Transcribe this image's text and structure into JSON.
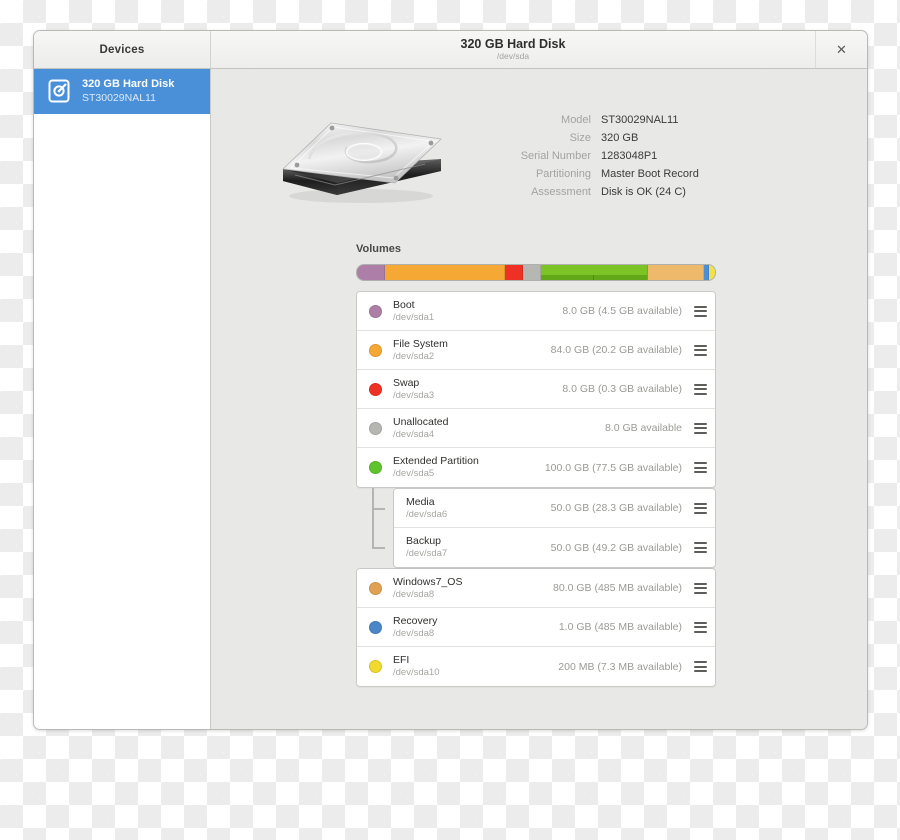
{
  "window": {
    "title": "320 GB Hard Disk",
    "subtitle": "/dev/sda",
    "close_label": "✕"
  },
  "sidebar": {
    "header_label": "Devices",
    "devices": [
      {
        "name": "320 GB Hard Disk",
        "model": "ST30029NAL11",
        "icon": "hard-disk-icon",
        "selected": true
      }
    ]
  },
  "disk": {
    "illustration": "hard-disk-illustration",
    "info": [
      {
        "label": "Model",
        "value": "ST30029NAL11"
      },
      {
        "label": "Size",
        "value": "320 GB"
      },
      {
        "label": "Serial Number",
        "value": "1283048P1"
      },
      {
        "label": "Partitioning",
        "value": "Master Boot Record"
      },
      {
        "label": "Assessment",
        "value": "Disk is OK (24 C)"
      }
    ]
  },
  "volumes": {
    "heading": "Volumes",
    "bar_segments": [
      {
        "name": "Boot",
        "color": "#ad7fa8",
        "pct": 7.8
      },
      {
        "name": "File System",
        "color": "#f5a833",
        "pct": 33.6
      },
      {
        "name": "Swap",
        "color": "#ee3124",
        "pct": 5.0
      },
      {
        "name": "Unallocated",
        "color": "#b6b6b2",
        "pct": 5.0
      },
      {
        "name": "Extended Partition",
        "color": "#7cc425",
        "pct": 30.0,
        "children": [
          {
            "name": "Media",
            "color": "#62a717",
            "pct": 50
          },
          {
            "name": "Backup",
            "color": "#62a717",
            "pct": 50
          }
        ]
      },
      {
        "name": "Windows7_OS",
        "color": "#eeb96b",
        "pct": 15.4
      },
      {
        "name": "Recovery",
        "color": "#4a90d9",
        "pct": 1.4
      },
      {
        "name": "EFI",
        "color": "#f3e04a",
        "pct": 1.8
      }
    ],
    "rows": [
      {
        "name": "Boot",
        "device": "/dev/sda1",
        "size": "8.0 GB (4.5 GB available)",
        "color": "#ad7fa8",
        "nested": false
      },
      {
        "name": "File System",
        "device": "/dev/sda2",
        "size": "84.0 GB (20.2 GB available)",
        "color": "#f5a833",
        "nested": false
      },
      {
        "name": "Swap",
        "device": "/dev/sda3",
        "size": "8.0 GB (0.3 GB available)",
        "color": "#ee3124",
        "nested": false
      },
      {
        "name": "Unallocated",
        "device": "/dev/sda4",
        "size": "8.0 GB available",
        "color": "#b6b6b2",
        "nested": false
      },
      {
        "name": "Extended Partition",
        "device": "/dev/sda5",
        "size": "100.0 GB (77.5 GB available)",
        "color": "#5ec32c",
        "nested": false
      },
      {
        "name": "Media",
        "device": "/dev/sda6",
        "size": "50.0 GB (28.3 GB available)",
        "color": null,
        "nested": true
      },
      {
        "name": "Backup",
        "device": "/dev/sda7",
        "size": "50.0 GB (49.2 GB available)",
        "color": null,
        "nested": true
      },
      {
        "name": "Windows7_OS",
        "device": "/dev/sda8",
        "size": "80.0 GB (485 MB available)",
        "color": "#e0a252",
        "nested": false
      },
      {
        "name": "Recovery",
        "device": "/dev/sda8",
        "size": "1.0 GB (485 MB available)",
        "color": "#4a86c8",
        "nested": false
      },
      {
        "name": "EFI",
        "device": "/dev/sda10",
        "size": "200 MB (7.3 MB available)",
        "color": "#f1d92e",
        "nested": false
      }
    ],
    "menu_icon": "hamburger-menu-icon"
  }
}
